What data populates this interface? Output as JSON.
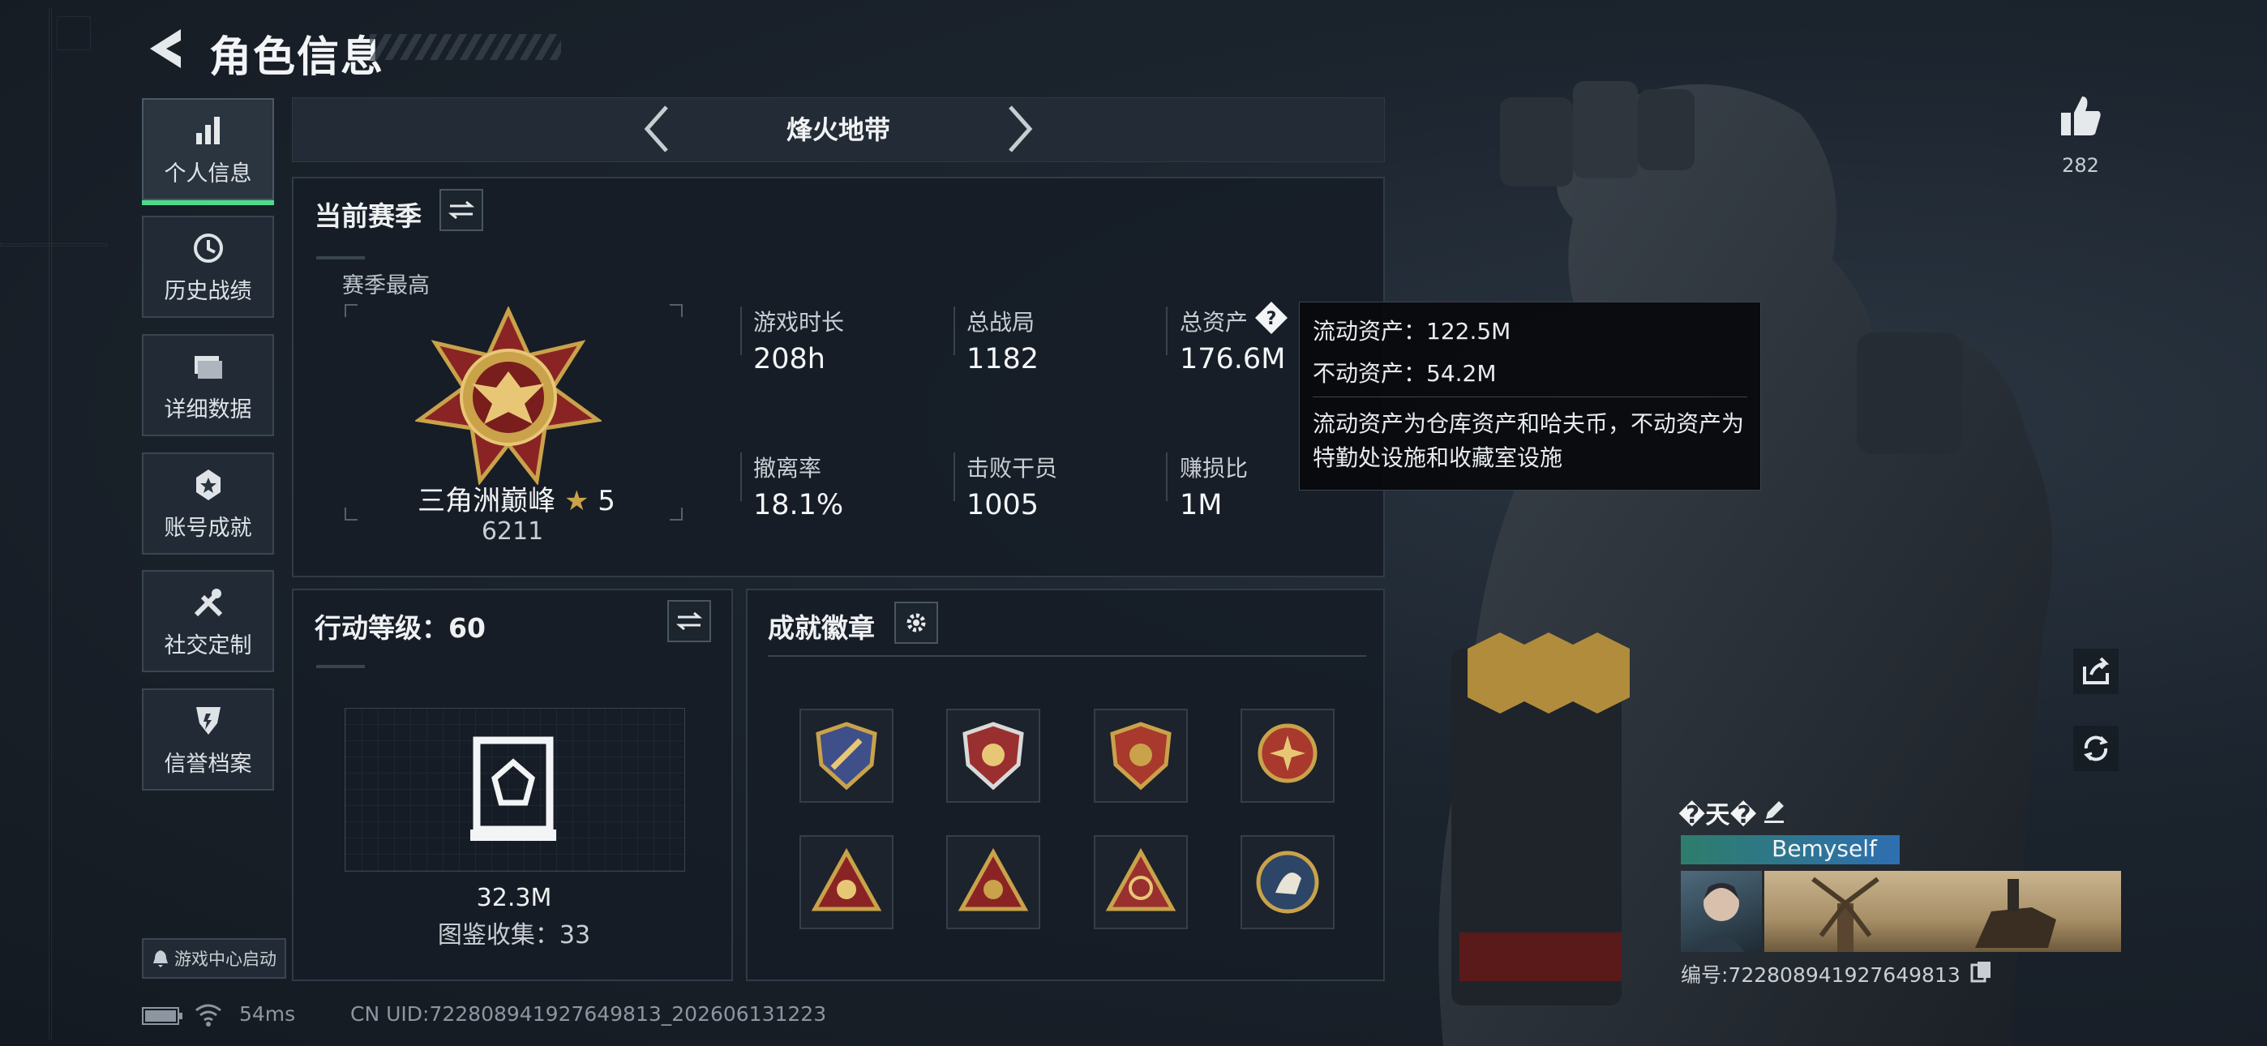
{
  "header": {
    "title": "角色信息"
  },
  "sidebar": {
    "items": [
      {
        "label": "个人信息",
        "icon": "bar-chart-icon"
      },
      {
        "label": "历史战绩",
        "icon": "history-icon"
      },
      {
        "label": "详细数据",
        "icon": "folder-icon"
      },
      {
        "label": "账号成就",
        "icon": "achievement-icon"
      },
      {
        "label": "社交定制",
        "icon": "tools-icon"
      },
      {
        "label": "信誉档案",
        "icon": "reputation-icon"
      }
    ],
    "launch_label": "游戏中心启动"
  },
  "mode": {
    "title": "烽火地带"
  },
  "season": {
    "title": "当前赛季",
    "best_label": "赛季最高",
    "rank_name": "三角洲巅峰",
    "rank_stars": "5",
    "rank_score": "6211",
    "stats": [
      {
        "label": "游戏时长",
        "value": "208h"
      },
      {
        "label": "总战局",
        "value": "1182"
      },
      {
        "label": "总资产",
        "value": "176.6M"
      },
      {
        "label": "撤离率",
        "value": "18.1%"
      },
      {
        "label": "击败干员",
        "value": "1005"
      },
      {
        "label": "赚损比",
        "value": "1M"
      }
    ]
  },
  "tooltip": {
    "liquid": "流动资产：122.5M",
    "fixed": "不动资产：54.2M",
    "desc": "流动资产为仓库资产和哈夫币，不动资产为特勤处设施和收藏室设施"
  },
  "action": {
    "title": "行动等级：60",
    "value": "32.3M",
    "collection": "图鉴收集：33"
  },
  "badges": {
    "title": "成就徽章"
  },
  "likes": {
    "count": "282"
  },
  "player": {
    "name": "�天�",
    "tag": "Bemyself",
    "id": "编号:722808941927649813"
  },
  "status": {
    "ping": "54ms",
    "uid": "CN UID:722808941927649813_202606131223"
  },
  "colors": {
    "accent": "#4ddc8c",
    "gold": "#c9a24a"
  }
}
